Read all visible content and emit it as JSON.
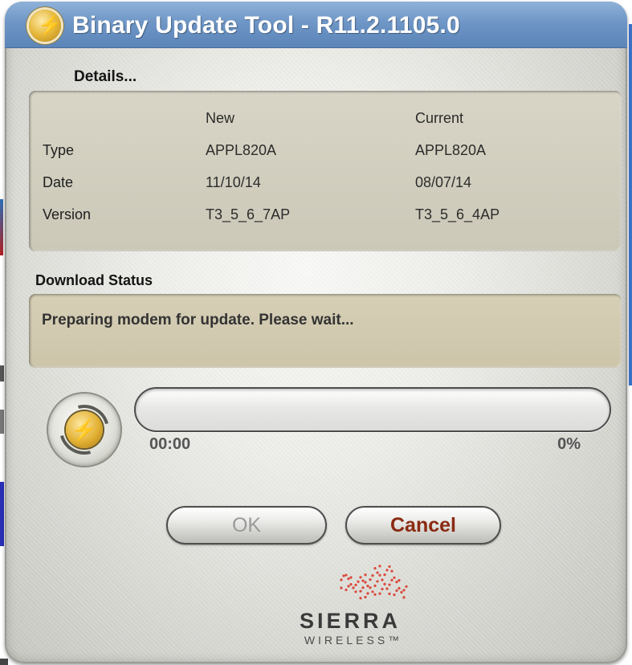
{
  "window": {
    "title": "Binary Update Tool - R11.2.1105.0"
  },
  "details": {
    "heading": "Details...",
    "columns": [
      "New",
      "Current"
    ],
    "rows": [
      {
        "label": "Type",
        "new": "APPL820A",
        "current": "APPL820A"
      },
      {
        "label": "Date",
        "new": "11/10/14",
        "current": "08/07/14"
      },
      {
        "label": "Version",
        "new": "T3_5_6_7AP",
        "current": "T3_5_6_4AP"
      }
    ]
  },
  "download_status": {
    "heading": "Download Status",
    "message": "Preparing modem for update.  Please wait..."
  },
  "progress": {
    "elapsed": "00:00",
    "percent_label": "0%",
    "fraction": 0
  },
  "buttons": {
    "ok_label": "OK",
    "cancel_label": "Cancel"
  },
  "brand": {
    "name": "SIERRA",
    "subtitle": "WIRELESS™"
  },
  "colors": {
    "titlebar": "#6e96c6",
    "cancel_text": "#8a2a12",
    "brand_mark": "#d9483a"
  },
  "icons": [
    "app-logo-icon",
    "update-bolt-icon",
    "sierra-wireless-logo-icon"
  ]
}
